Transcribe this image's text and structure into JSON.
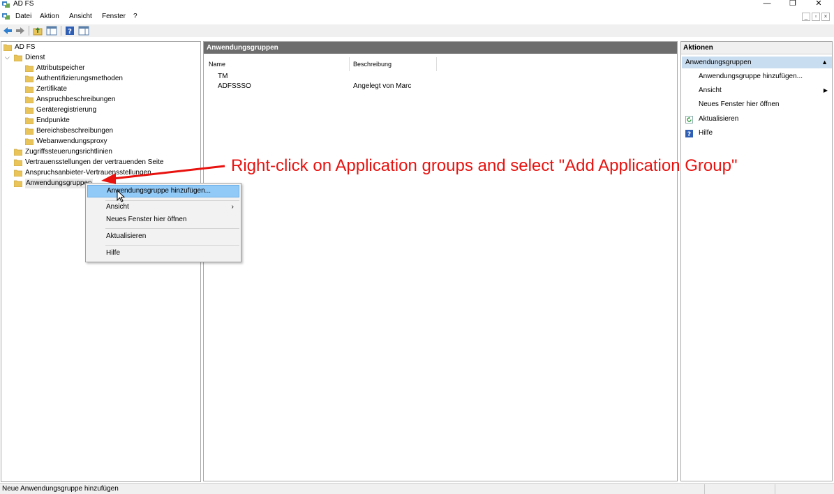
{
  "window": {
    "title": "AD FS",
    "minimize_glyph": "—",
    "restore_glyph": "❐",
    "close_glyph": "✕"
  },
  "menu": {
    "items": [
      "Datei",
      "Aktion",
      "Ansicht",
      "Fenster",
      "?"
    ],
    "mdi_buttons": [
      "_",
      "▫",
      "×"
    ]
  },
  "toolbar": {
    "icons": [
      "back-arrow-icon",
      "forward-arrow-icon",
      "up-folder-icon",
      "show-hide-tree-icon",
      "help-icon",
      "properties-icon"
    ]
  },
  "tree": {
    "root": "AD FS",
    "service": "Dienst",
    "service_children": [
      "Attributspeicher",
      "Authentifizierungsmethoden",
      "Zertifikate",
      "Anspruchbeschreibungen",
      "Geräteregistrierung",
      "Endpunkte",
      "Bereichsbeschreibungen",
      "Webanwendungsproxy"
    ],
    "top_items": [
      "Zugriffssteuerungsrichtlinien",
      "Vertrauensstellungen der vertrauenden Seite",
      "Anspruchsanbieter-Vertrauensstellungen",
      "Anwendungsgruppen"
    ]
  },
  "center": {
    "header": "Anwendungsgruppen",
    "columns": [
      "Name",
      "Beschreibung"
    ],
    "rows": [
      {
        "name": "TM",
        "description": ""
      },
      {
        "name": "ADFSSSO",
        "description": "Angelegt von Marc"
      }
    ]
  },
  "actions": {
    "title": "Aktionen",
    "group": "Anwendungsgruppen",
    "collapse_glyph": "▲",
    "items": [
      {
        "label": "Anwendungsgruppe hinzufügen...",
        "icon": ""
      },
      {
        "label": "Ansicht",
        "icon": "",
        "submenu": "▶"
      },
      {
        "label": "Neues Fenster hier öffnen",
        "icon": ""
      },
      {
        "label": "Aktualisieren",
        "icon": "refresh-icon"
      },
      {
        "label": "Hilfe",
        "icon": "help-icon"
      }
    ]
  },
  "context_menu": {
    "items": [
      {
        "label": "Anwendungsgruppe hinzufügen...",
        "highlighted": true
      },
      {
        "label": "Ansicht",
        "submenu": "›"
      },
      {
        "label": "Neues Fenster hier öffnen"
      },
      {
        "label": "Aktualisieren"
      },
      {
        "label": "Hilfe"
      }
    ]
  },
  "annotation": {
    "text": "Right-click on Application groups and select \"Add Application Group\"",
    "color": "#e8120f"
  },
  "status": {
    "text": "Neue Anwendungsgruppe hinzufügen"
  },
  "colors": {
    "folder": "#e8c45a",
    "center_header_bg": "#6d6d6d",
    "action_group_bg": "#c9ddf0",
    "context_highlight": "#91c9f7"
  }
}
